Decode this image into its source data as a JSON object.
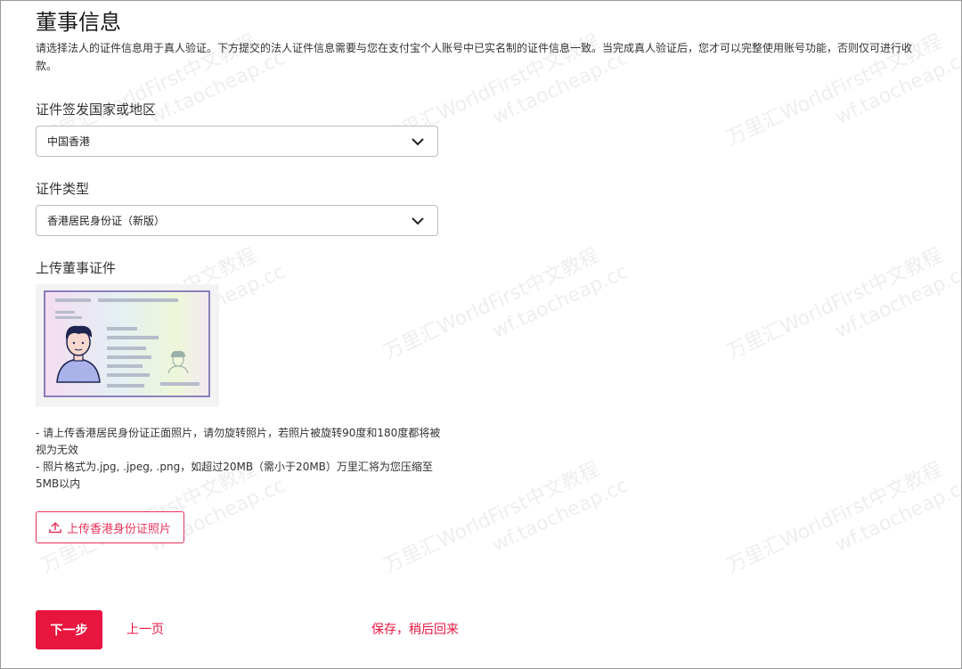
{
  "page": {
    "title": "董事信息",
    "intro": "请选择法人的证件信息用于真人验证。下方提交的法人证件信息需要与您在支付宝个人账号中已实名制的证件信息一致。当完成真人验证后，您才可以完整使用账号功能，否则仅可进行收款。"
  },
  "country_field": {
    "label": "证件签发国家或地区",
    "value": "中国香港"
  },
  "id_type_field": {
    "label": "证件类型",
    "value": "香港居民身份证（新版）"
  },
  "upload_section": {
    "label": "上传董事证件",
    "note1": "- 请上传香港居民身份证正面照片，请勿旋转照片，若照片被旋转90度和180度都将被视为无效",
    "note2": "- 照片格式为.jpg, .jpeg, .png，如超过20MB（需小于20MB）万里汇将为您压缩至5MB以内",
    "button_label": "上传香港身份证照片"
  },
  "footer": {
    "next_label": "下一步",
    "prev_label": "上一页",
    "save_label": "保存，稍后回来"
  },
  "watermark": {
    "line1": "万里汇WorldFirst中文教程",
    "line2": "wf.taocheap.cc"
  },
  "colors": {
    "accent": "#e8153f",
    "border": "#bdbdbd"
  }
}
